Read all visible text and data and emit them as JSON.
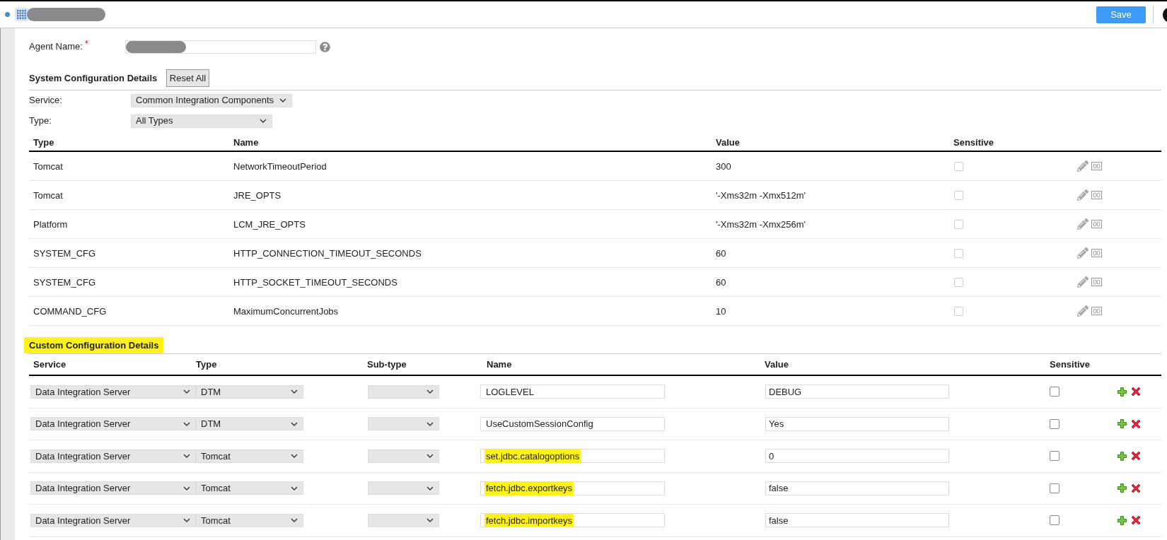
{
  "header": {
    "save_button": "Save"
  },
  "agent": {
    "label": "Agent Name:",
    "required_mark": "*"
  },
  "system_config": {
    "title": "System Configuration Details",
    "reset_button": "Reset All",
    "filters": [
      {
        "label": "Service:",
        "value": "Common Integration Components"
      },
      {
        "label": "Type:",
        "value": "All Types"
      }
    ],
    "table": {
      "columns": [
        "Type",
        "Name",
        "Value",
        "Sensitive"
      ],
      "rows": [
        {
          "type": "Tomcat",
          "name": "NetworkTimeoutPeriod",
          "value": "300",
          "sensitive": false,
          "sensitive_disabled": true
        },
        {
          "type": "Tomcat",
          "name": "JRE_OPTS",
          "value": "'-Xms32m -Xmx512m'",
          "sensitive": false,
          "sensitive_disabled": true
        },
        {
          "type": "Platform",
          "name": "LCM_JRE_OPTS",
          "value": "'-Xms32m -Xmx256m'",
          "sensitive": false,
          "sensitive_disabled": true
        },
        {
          "type": "SYSTEM_CFG",
          "name": "HTTP_CONNECTION_TIMEOUT_SECONDS",
          "value": "60",
          "sensitive": false,
          "sensitive_disabled": true
        },
        {
          "type": "SYSTEM_CFG",
          "name": "HTTP_SOCKET_TIMEOUT_SECONDS",
          "value": "60",
          "sensitive": false,
          "sensitive_disabled": true
        },
        {
          "type": "COMMAND_CFG",
          "name": "MaximumConcurrentJobs",
          "value": "10",
          "sensitive": false,
          "sensitive_disabled": true
        }
      ]
    }
  },
  "custom_config": {
    "title": "Custom Configuration Details",
    "title_highlighted": true,
    "table": {
      "columns": [
        "Service",
        "Type",
        "Sub-type",
        "Name",
        "Value",
        "Sensitive"
      ],
      "rows": [
        {
          "service": "Data Integration Server",
          "type": "DTM",
          "name": "LOGLEVEL",
          "name_highlighted": false,
          "value": "DEBUG",
          "sensitive": false
        },
        {
          "service": "Data Integration Server",
          "type": "DTM",
          "name": "UseCustomSessionConfig",
          "name_highlighted": false,
          "value": "Yes",
          "sensitive": false
        },
        {
          "service": "Data Integration Server",
          "type": "Tomcat",
          "name": "set.jdbc.catalogoptions",
          "name_highlighted": true,
          "value": "0",
          "sensitive": false
        },
        {
          "service": "Data Integration Server",
          "type": "Tomcat",
          "name": "fetch.jdbc.exportkeys",
          "name_highlighted": true,
          "value": "false",
          "sensitive": false
        },
        {
          "service": "Data Integration Server",
          "type": "Tomcat",
          "name": "fetch.jdbc.importkeys",
          "name_highlighted": true,
          "value": "false",
          "sensitive": false
        }
      ]
    }
  }
}
